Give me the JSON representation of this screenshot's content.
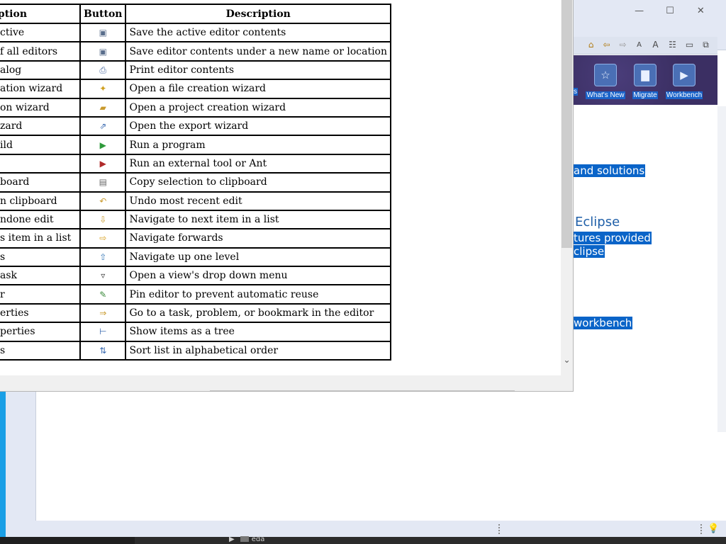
{
  "help_table": {
    "headers": [
      "ption",
      "Button",
      "Description"
    ],
    "rows": [
      {
        "cmd": "ctive",
        "icon": "save-icon",
        "glyph": "▣",
        "color": "#5a6e8c",
        "desc": "Save the active editor contents"
      },
      {
        "cmd": "f all editors",
        "icon": "save-as-icon",
        "glyph": "▣",
        "color": "#5a6e8c",
        "desc": "Save editor contents under a new name or location"
      },
      {
        "cmd": "alog",
        "icon": "print-icon",
        "glyph": "⎙",
        "color": "#4a6aa0",
        "desc": "Print editor contents"
      },
      {
        "cmd": "ation wizard",
        "icon": "new-file-icon",
        "glyph": "✦",
        "color": "#d0a020",
        "desc": "Open a file creation wizard"
      },
      {
        "cmd": "on wizard",
        "icon": "new-project-icon",
        "glyph": "▰",
        "color": "#c99a2e",
        "desc": "Open a project creation wizard"
      },
      {
        "cmd": "zard",
        "icon": "export-icon",
        "glyph": "⇗",
        "color": "#3a6ab0",
        "desc": "Open the export wizard"
      },
      {
        "cmd": "ild",
        "icon": "run-icon",
        "glyph": "▶",
        "color": "#2e9a3a",
        "desc": "Run a program"
      },
      {
        "cmd": "",
        "icon": "external-tool-icon",
        "glyph": "▶",
        "color": "#b02a2a",
        "desc": "Run an external tool or Ant"
      },
      {
        "cmd": "board",
        "icon": "copy-icon",
        "glyph": "▤",
        "color": "#6a6a6a",
        "desc": "Copy selection to clipboard"
      },
      {
        "cmd": "n clipboard",
        "icon": "undo-icon",
        "glyph": "↶",
        "color": "#c99a2e",
        "desc": "Undo most recent edit"
      },
      {
        "cmd": "ndone edit",
        "icon": "next-item-icon",
        "glyph": "⇩",
        "color": "#c99a2e",
        "desc": "Navigate to next item in a list"
      },
      {
        "cmd": "s item in a list",
        "icon": "forward-icon",
        "glyph": "⇨",
        "color": "#d8a020",
        "desc": "Navigate forwards"
      },
      {
        "cmd": "s",
        "icon": "up-level-icon",
        "glyph": "⇧",
        "color": "#3a7ab8",
        "desc": "Navigate up one level"
      },
      {
        "cmd": "ask",
        "icon": "dropdown-menu-icon",
        "glyph": "▿",
        "color": "#333333",
        "desc": "Open a view's drop down menu"
      },
      {
        "cmd": "r",
        "icon": "pin-editor-icon",
        "glyph": "✎",
        "color": "#3a8a3a",
        "desc": "Pin editor to prevent automatic reuse"
      },
      {
        "cmd": "erties",
        "icon": "goto-marker-icon",
        "glyph": "⇒",
        "color": "#c99a2e",
        "desc": "Go to a task, problem, or bookmark in the editor"
      },
      {
        "cmd": "perties",
        "icon": "tree-icon",
        "glyph": "⊢",
        "color": "#3a6ab0",
        "desc": "Show items as a tree"
      },
      {
        "cmd": "s",
        "icon": "sort-icon",
        "glyph": "⇅",
        "color": "#3a6ab0",
        "desc": "Sort list in alphabetical order"
      }
    ]
  },
  "welcome": {
    "banner_items": [
      {
        "label": "What's New",
        "icon": "star-icon",
        "glyph": "☆"
      },
      {
        "label": "Migrate",
        "icon": "briefcase-icon",
        "glyph": "▇"
      },
      {
        "label": "Workbench",
        "icon": "play-icon",
        "glyph": "▶"
      }
    ],
    "banner_partial_label": "s",
    "texts": {
      "solutions": "and solutions",
      "heading": "Eclipse",
      "features": "tures provided",
      "eclipse": "clipse",
      "workbench": "workbench"
    }
  },
  "window_controls": {
    "minimize": "—",
    "maximize": "☐",
    "close": "✕"
  },
  "taskbar": {
    "item": "eda"
  },
  "colors": {
    "highlight": "#0a64c8",
    "banner": "#3b2f63",
    "desktop": "#1a9fe6"
  }
}
